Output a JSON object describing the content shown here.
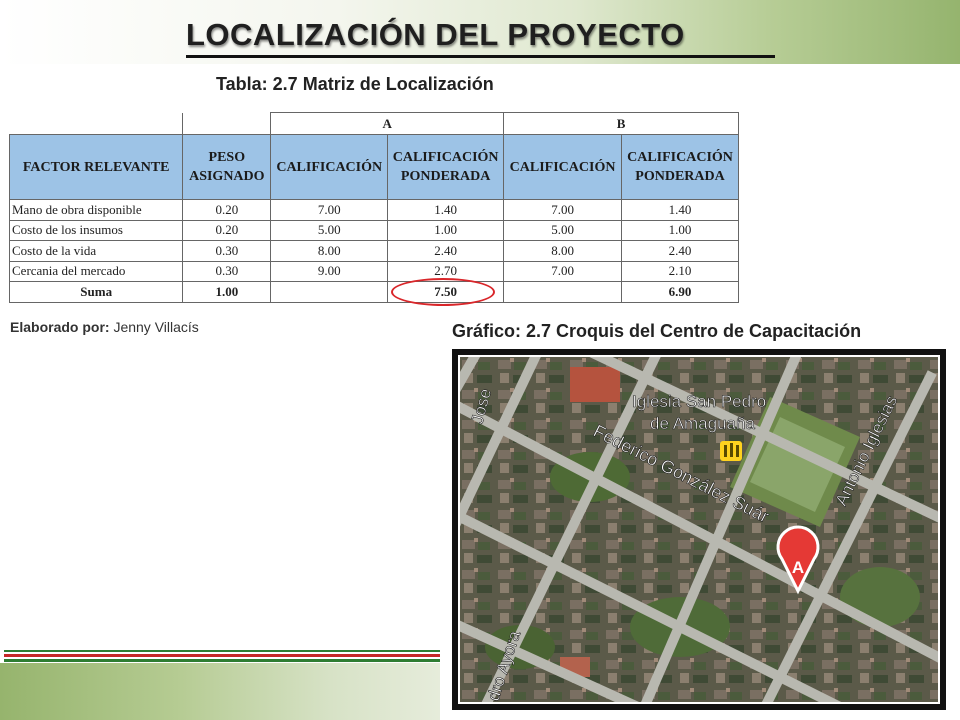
{
  "slide": {
    "title": "LOCALIZACIÓN DEL PROYECTO",
    "table_caption": "Tabla: 2.7 Matriz de Localización",
    "credit_label": "Elaborado por:",
    "credit_name": "Jenny Villacís",
    "graph_caption": "Gráfico: 2.7 Croquis del Centro de Capacitación"
  },
  "table": {
    "group_a": "A",
    "group_b": "B",
    "headers": {
      "factor": "FACTOR RELEVANTE",
      "peso_1": "PESO",
      "peso_2": "ASIGNADO",
      "cal_a": "CALIFICACIÓN",
      "pond_a_1": "CALIFICACIÓN",
      "pond_a_2": "PONDERADA",
      "cal_b": "CALIFICACIÓN",
      "pond_b_1": "CALIFICACIÓN",
      "pond_b_2": "PONDERADA"
    },
    "rows": [
      {
        "factor": "Mano de obra disponible",
        "peso": "0.20",
        "cal_a": "7.00",
        "pond_a": "1.40",
        "cal_b": "7.00",
        "pond_b": "1.40"
      },
      {
        "factor": "Costo de los insumos",
        "peso": "0.20",
        "cal_a": "5.00",
        "pond_a": "1.00",
        "cal_b": "5.00",
        "pond_b": "1.00"
      },
      {
        "factor": "Costo de la vida",
        "peso": "0.30",
        "cal_a": "8.00",
        "pond_a": "2.40",
        "cal_b": "8.00",
        "pond_b": "2.40"
      },
      {
        "factor": "Cercania del mercado",
        "peso": "0.30",
        "cal_a": "9.00",
        "pond_a": "2.70",
        "cal_b": "7.00",
        "pond_b": "2.10"
      }
    ],
    "sum": {
      "label": "Suma",
      "peso": "1.00",
      "pond_a": "7.50",
      "pond_b": "6.90"
    }
  },
  "map": {
    "church_label_1": "Iglesia San Pedro",
    "church_label_2": "de Amaguaña",
    "street_jose": "Jose",
    "street_federico": "Federico González Suár",
    "street_antonio": "Antonio Iglesias",
    "street_ayora": "dro Ayora",
    "pin_label": "A"
  },
  "colors": {
    "header_fill": "#9dc3e6",
    "oval": "#d9262a",
    "banner_green": "#95b46e",
    "pin_red": "#e53935"
  }
}
